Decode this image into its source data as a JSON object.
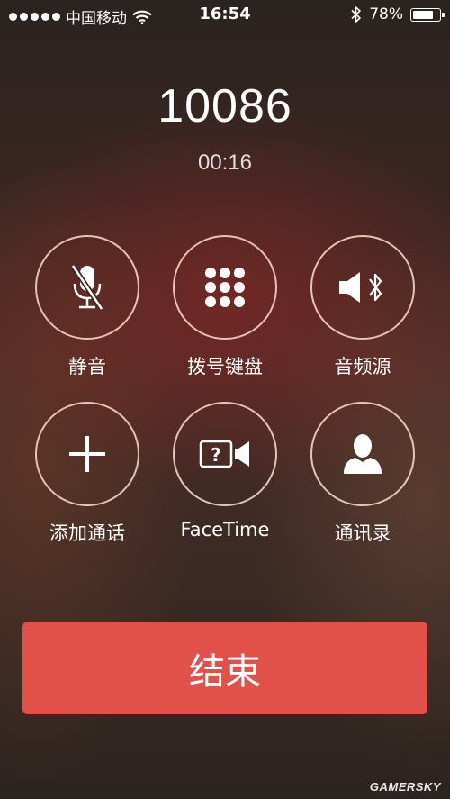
{
  "status_bar": {
    "carrier": "中国移动",
    "time": "16:54",
    "battery_percent": "78%",
    "battery_level": 0.78,
    "signal_dots": 5,
    "icons": [
      "signal-dots-icon",
      "wifi-icon",
      "bluetooth-icon",
      "battery-icon"
    ]
  },
  "call": {
    "number": "10086",
    "duration": "00:16"
  },
  "controls": [
    {
      "label": "静音",
      "icon": "mute-icon"
    },
    {
      "label": "拨号键盘",
      "icon": "keypad-icon"
    },
    {
      "label": "音频源",
      "icon": "audio-source-icon"
    },
    {
      "label": "添加通话",
      "icon": "add-call-icon"
    },
    {
      "label": "FaceTime",
      "icon": "facetime-icon"
    },
    {
      "label": "通讯录",
      "icon": "contacts-icon"
    }
  ],
  "end_call": {
    "label": "结束",
    "color": "#e2504a"
  },
  "watermark": "GAMERSKY"
}
